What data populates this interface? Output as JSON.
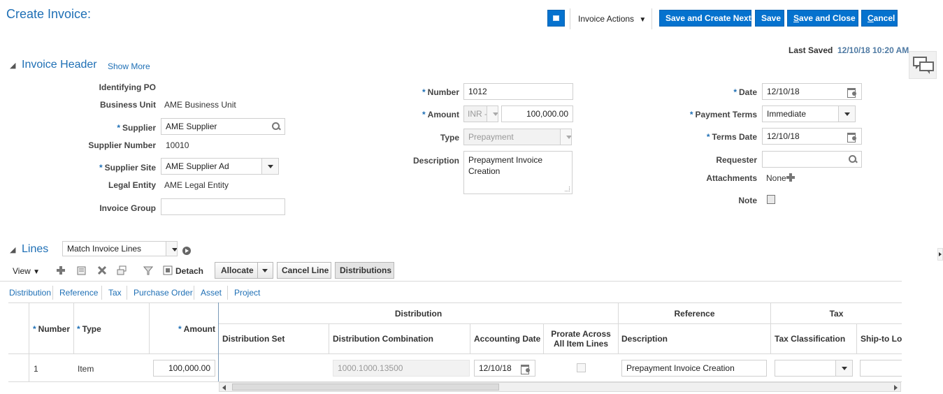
{
  "page": {
    "title": "Create Invoice:"
  },
  "toolbar": {
    "invoice_actions": "Invoice Actions",
    "save_and_create_next": "Save and Create Next",
    "save": "Save",
    "save_and_close_underline": "S",
    "save_and_close_rest": "ave and Close",
    "cancel_underline": "C",
    "cancel_rest": "ancel"
  },
  "last_saved": {
    "label": "Last Saved",
    "value": "12/10/18 10:20 AM"
  },
  "header": {
    "title": "Invoice Header",
    "show_more": "Show More",
    "identifying_po_label": "Identifying PO",
    "business_unit_label": "Business Unit",
    "business_unit_value": "AME Business Unit",
    "supplier_label": "Supplier",
    "supplier_value": "AME Supplier",
    "supplier_number_label": "Supplier Number",
    "supplier_number_value": "10010",
    "supplier_site_label": "Supplier Site",
    "supplier_site_value": "AME Supplier Ad",
    "legal_entity_label": "Legal Entity",
    "legal_entity_value": "AME Legal Entity",
    "invoice_group_label": "Invoice Group",
    "invoice_group_value": "",
    "number_label": "Number",
    "number_value": "1012",
    "amount_label": "Amount",
    "currency_value": "INR -",
    "amount_value": "100,000.00",
    "type_label": "Type",
    "type_value": "Prepayment",
    "description_label": "Description",
    "description_value": "Prepayment Invoice Creation",
    "date_label": "Date",
    "date_value": "12/10/18",
    "payment_terms_label": "Payment Terms",
    "payment_terms_value": "Immediate",
    "terms_date_label": "Terms Date",
    "terms_date_value": "12/10/18",
    "requester_label": "Requester",
    "requester_value": "",
    "attachments_label": "Attachments",
    "attachments_value": "None",
    "note_label": "Note",
    "required_marker": "*"
  },
  "lines": {
    "title": "Lines",
    "match_select": "Match Invoice Lines",
    "view": "View",
    "detach": "Detach",
    "allocate": "Allocate",
    "cancel_line": "Cancel Line",
    "distributions": "Distributions",
    "tabs": [
      "Distribution",
      "Reference",
      "Tax",
      "Purchase Order",
      "Asset",
      "Project"
    ],
    "group_headers": {
      "distribution": "Distribution",
      "reference": "Reference",
      "tax": "Tax"
    },
    "columns": {
      "number": "Number",
      "type": "Type",
      "amount": "Amount",
      "distribution_set": "Distribution Set",
      "distribution_combination": "Distribution Combination",
      "accounting_date": "Accounting Date",
      "prorate_line1": "Prorate Across",
      "prorate_line2": "All Item Lines",
      "description": "Description",
      "tax_classification": "Tax Classification",
      "ship_to_location": "Ship-to Loc"
    },
    "row": {
      "number": "1",
      "type": "Item",
      "amount": "100,000.00",
      "distribution_set": "",
      "distribution_combination": "1000.1000.13500",
      "accounting_date": "12/10/18",
      "description": "Prepayment Invoice Creation",
      "tax_classification": "",
      "ship_to_location": ""
    }
  }
}
